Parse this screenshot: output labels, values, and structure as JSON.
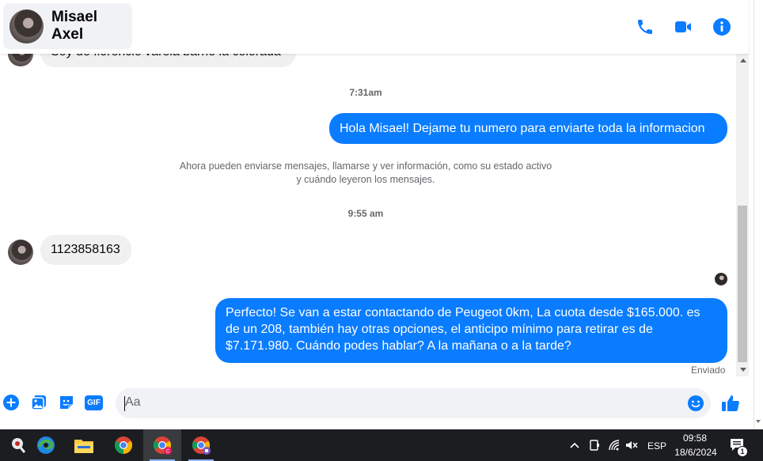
{
  "header": {
    "contact_name": "Misael Axel",
    "icons": [
      "phone-icon",
      "video-icon",
      "info-icon"
    ],
    "accent_color": "#0a7cff"
  },
  "messages": {
    "partial_incoming": "Soy de florencio varela barrio la colorada",
    "stamp_1": "7:31am",
    "outgoing_1": "Hola Misael! Dejame tu numero para enviarte toda la informacion",
    "notice": "Ahora pueden enviarse mensajes, llamarse y ver información, como su estado activo y cuándo leyeron los mensajes.",
    "stamp_2": "9:55 am",
    "incoming_number": "1123858163",
    "outgoing_2": "Perfecto!  Se van a estar contactando de Peugeot 0km, La cuota desde $165.000. es de un 208, también hay otras opciones, el anticipo mínimo para retirar es de $7.171.980. Cuándo podes hablar? A la mañana o a la tarde?",
    "status": "Enviado"
  },
  "composer": {
    "placeholder": "Aa",
    "icons": [
      "plus-icon",
      "gallery-icon",
      "sticker-icon",
      "gif-icon",
      "emoji-icon",
      "like-icon"
    ],
    "gif_label": "GIF"
  },
  "taskbar": {
    "apps": [
      "system-app-icon",
      "edge-icon",
      "file-explorer-icon",
      "chrome-icon",
      "chrome-profile-icon",
      "chrome-profile-icon-2"
    ],
    "language": "ESP",
    "time": "09:58",
    "date": "18/6/2024",
    "notification_count": "1"
  }
}
